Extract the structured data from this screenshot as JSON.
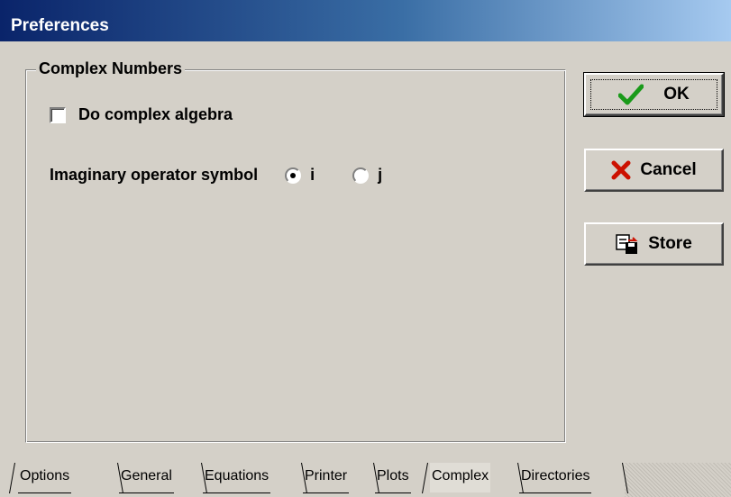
{
  "window": {
    "title": "Preferences"
  },
  "group": {
    "legend": "Complex Numbers"
  },
  "checkbox": {
    "label": "Do complex algebra",
    "checked": false
  },
  "imaginary": {
    "label": "Imaginary operator symbol",
    "options": [
      {
        "label": "i",
        "selected": true
      },
      {
        "label": "j",
        "selected": false
      }
    ]
  },
  "buttons": {
    "ok": "OK",
    "cancel": "Cancel",
    "store": "Store"
  },
  "tabs": [
    {
      "label": "Options"
    },
    {
      "label": "General"
    },
    {
      "label": "Equations"
    },
    {
      "label": "Printer"
    },
    {
      "label": "Plots"
    },
    {
      "label": "Complex",
      "active": true
    },
    {
      "label": "Directories"
    }
  ],
  "colors": {
    "title_start": "#0a246a",
    "title_end": "#a6caf0",
    "face": "#d4d0c8",
    "ok_check": "#1a9a1a",
    "cancel_x": "#cc1100"
  }
}
